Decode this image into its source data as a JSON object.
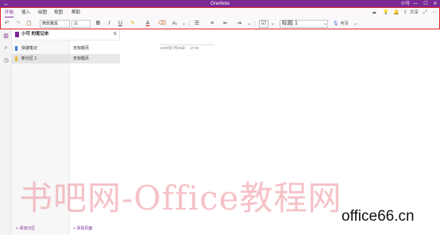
{
  "window": {
    "title": "OneNote",
    "user": "小可",
    "back": "←",
    "controls": {
      "minimize": "—",
      "maximize": "☐",
      "close": "✕"
    }
  },
  "menu": {
    "tabs": [
      {
        "label": "开始"
      },
      {
        "label": "插入"
      },
      {
        "label": "绘图"
      },
      {
        "label": "视图"
      },
      {
        "label": "帮助"
      }
    ],
    "active": "开始"
  },
  "menu_right": {
    "share_label": "共享",
    "more": "⋯"
  },
  "ribbon": {
    "undo": "↶",
    "redo": "↷",
    "clipboard": "📋",
    "font_name": "微软雅黑",
    "font_size": "11",
    "bold": "B",
    "italic": "I",
    "underline": "U",
    "highlight": "✎",
    "font_color": "A",
    "eraser": "⌫",
    "format": "Aᵥ",
    "dropdown": "⌄",
    "bullets": "☰",
    "numbering": "≡",
    "outdent": "⇤",
    "indent": "⇥",
    "list_more": "⌄",
    "checkbox": "☑",
    "checkbox_more": "⌄",
    "style_value": "标题 1",
    "tag_icon": "🎙",
    "tag_label": "听写",
    "more": "⌄"
  },
  "rail": {
    "icons": [
      "notebooks-icon",
      "search-icon",
      "recent-icon"
    ]
  },
  "notebook": {
    "name": "小可 的笔记本",
    "sections": [
      {
        "label": "快速笔记",
        "color": "#3b78d8",
        "selected": false
      },
      {
        "label": "新分区 1",
        "color": "#e8b82e",
        "selected": true
      }
    ],
    "pages": [
      {
        "label": "无标题页",
        "selected": false
      },
      {
        "label": "无标题页",
        "selected": true
      }
    ],
    "add_section": "+ 添加分区",
    "add_page": "+ 添加页面"
  },
  "page": {
    "date": "2020年7月30日",
    "time": "17:00"
  },
  "watermark": {
    "text": "书吧网-Office教程网",
    "site": "office66.cn"
  }
}
